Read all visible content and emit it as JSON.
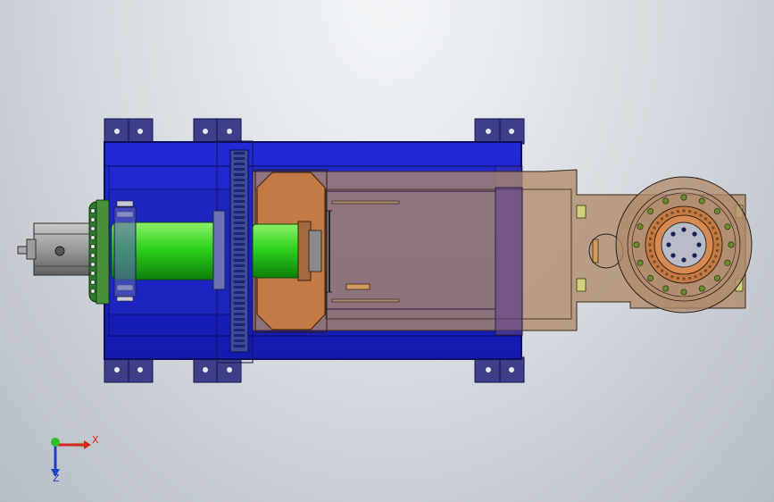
{
  "axes": {
    "x_label": "X",
    "z_label": "Z"
  },
  "colors": {
    "frame_blue": "#1a20c8",
    "frame_edge": "#0a0e5c",
    "bracket": "#3e3f88",
    "motor_gray": "#8e8e8e",
    "shaft_green": "#2fd21e",
    "copper": "#c47a45",
    "arm_tan": "#b08a6a",
    "bolt_green": "#6c8a2f",
    "axis_x": "#d8261f",
    "axis_y": "#2fbf28",
    "axis_z": "#1f3fc4"
  }
}
